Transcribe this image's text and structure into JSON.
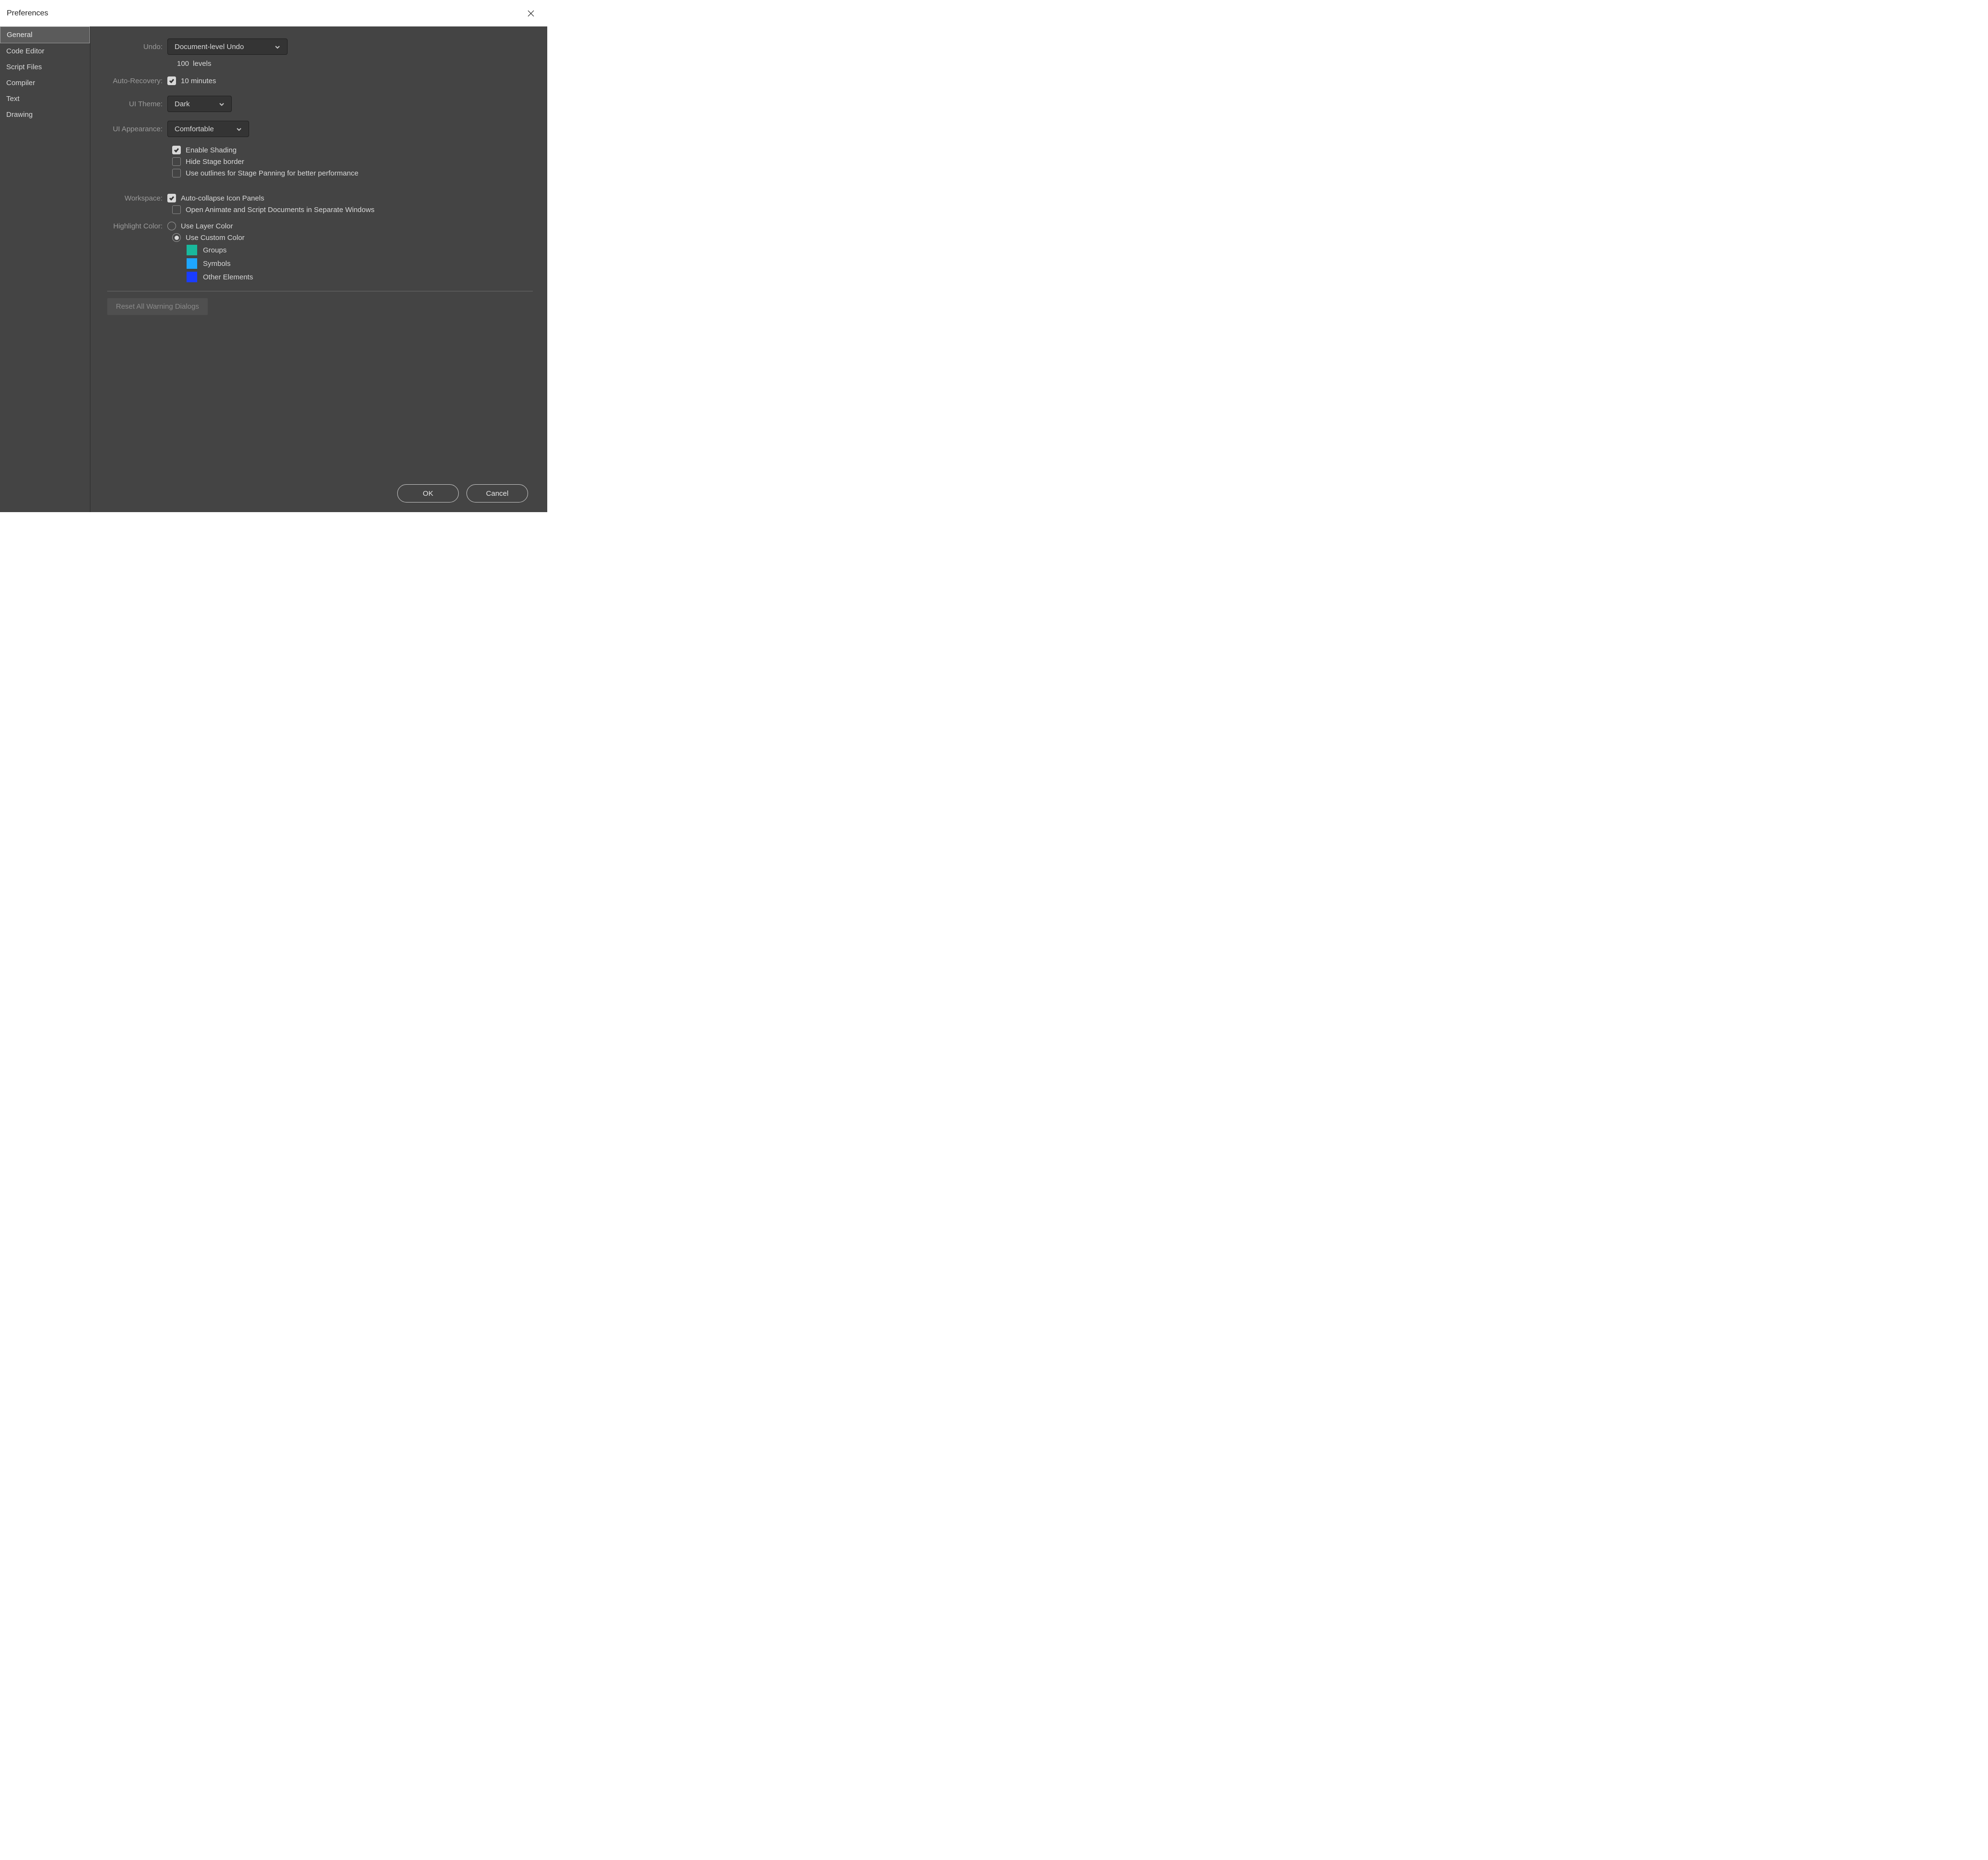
{
  "window": {
    "title": "Preferences"
  },
  "sidebar": {
    "items": [
      {
        "label": "General",
        "selected": true
      },
      {
        "label": "Code Editor",
        "selected": false
      },
      {
        "label": "Script Files",
        "selected": false
      },
      {
        "label": "Compiler",
        "selected": false
      },
      {
        "label": "Text",
        "selected": false
      },
      {
        "label": "Drawing",
        "selected": false
      }
    ]
  },
  "labels": {
    "undo": "Undo:",
    "auto_recovery": "Auto-Recovery:",
    "ui_theme": "UI Theme:",
    "ui_appearance": "UI Appearance:",
    "workspace": "Workspace:",
    "highlight_color": "Highlight Color:"
  },
  "undo": {
    "value": "Document-level Undo",
    "levels_count": "100",
    "levels_word": "levels"
  },
  "auto_recovery": {
    "checked": true,
    "text": "10 minutes"
  },
  "ui_theme": {
    "value": "Dark"
  },
  "ui_appearance": {
    "value": "Comfortable"
  },
  "appearance_opts": {
    "shading": {
      "label": "Enable Shading",
      "checked": true
    },
    "hide_border": {
      "label": "Hide Stage border",
      "checked": false
    },
    "outlines": {
      "label": "Use outlines for Stage Panning for better performance",
      "checked": false
    }
  },
  "workspace_opts": {
    "auto_collapse": {
      "label": "Auto-collapse Icon Panels",
      "checked": true
    },
    "separate_windows": {
      "label": "Open Animate and Script Documents in Separate Windows",
      "checked": false
    }
  },
  "highlight": {
    "layer": {
      "label": "Use Layer Color",
      "selected": false
    },
    "custom": {
      "label": "Use Custom Color",
      "selected": true
    },
    "colors": {
      "groups": {
        "label": "Groups",
        "hex": "#19b89c"
      },
      "symbols": {
        "label": "Symbols",
        "hex": "#1ea6ff"
      },
      "other": {
        "label": "Other Elements",
        "hex": "#1a3cff"
      }
    }
  },
  "buttons": {
    "reset": "Reset All Warning Dialogs",
    "ok": "OK",
    "cancel": "Cancel"
  }
}
